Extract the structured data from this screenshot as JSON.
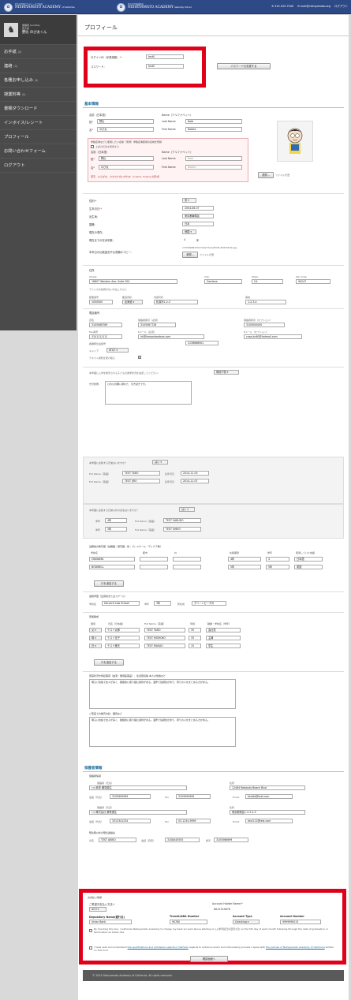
{
  "header": {
    "brand1_sub": "西大和学園アカデミーオブ米国",
    "brand1_name": "NISHIYAMATO ACADEMY",
    "brand1_loc": "of California",
    "brand2_sub": "西大和学園補習校",
    "brand2_name": "NISHIYAMATO ACADEMY",
    "brand2_loc": "Saturday School",
    "phone": "310-325-7040",
    "email": "mail@nishiyamato.org",
    "logout": "ログアウト"
  },
  "sidebar": {
    "user_role": "保護者 (Lomita)",
    "user_school": "西大和",
    "user_name": "野比 のび太くん",
    "items": [
      {
        "label": "お手紙",
        "count": "(0)"
      },
      {
        "label": "連絡",
        "count": "(0)"
      },
      {
        "label": "各種お申し込み",
        "count": "(0)"
      },
      {
        "label": "授業料等",
        "count": "(0)"
      },
      {
        "label": "書類ダウンロード",
        "count": ""
      },
      {
        "label": "インボイス/レシート",
        "count": ""
      },
      {
        "label": "プロフィール",
        "count": ""
      },
      {
        "label": "お問い合わせフォーム",
        "count": ""
      },
      {
        "label": "ログアウト",
        "count": ""
      }
    ]
  },
  "page": {
    "title": "プロフィール"
  },
  "login": {
    "id_label": "ログインID（半角英数）:",
    "id_value": "test0",
    "pw_label": "パスワード:",
    "pw_value": "test0",
    "pw_button": "パスワードを変更する"
  },
  "basic": {
    "title": "基本情報",
    "name_jp": "名前（日本語）",
    "name_en": "Name（アルファベット）",
    "sei_label": "姓",
    "sei": "野比",
    "mei_label": "名",
    "mei": "のび太",
    "last_label": "Last Name",
    "last": "Nobi",
    "first_label": "First Name",
    "first": "Nobita",
    "alias_note": "学籍名簿などに使用したい名前（筆頭）学籍名簿使用の名前を登録",
    "alias_check": "上記の氏名を使用する",
    "alias_sei": "野比",
    "alias_mei": "のび太",
    "alias_last": "Nobi",
    "alias_first": "Nobita",
    "alias_footer": "漢字、ひらがな、カタカナのいずれか（Lname, Fname の形式）",
    "photo_btn": "参照...",
    "photo_file": "ファイルが選",
    "gender_label": "性別:",
    "gender": "男",
    "dob_label": "生年月日:",
    "dob": "2004-06-07",
    "birthplace_label": "出生地:",
    "birthplace": "東京都練馬区",
    "nation_label": "国籍:",
    "nation": "日本",
    "visa_label": "現在の滞在:",
    "visa": "帰国",
    "years_label": "現在までの在米年数:",
    "years": "4",
    "years_unit": "年",
    "passport_label": "本年日の比較過去不る書類のコピー:",
    "passport_file": "17630988155474e077aaa83d6.45815632.jpg",
    "passport_btn": "参照..."
  },
  "address": {
    "title": "住所",
    "street_label": "Street:",
    "street": "16807 Western Ave, Suite 200",
    "city_label": "City:",
    "city": "Gardena",
    "state_label": "State:",
    "state": "CA",
    "zip_label": "Zip Code:",
    "zip": "90247",
    "jp_note": "アメリカの住所がない方はこちらに",
    "post_label": "郵便番号",
    "post": "1050000",
    "pref_label": "都道府県",
    "pref": "北海道",
    "city_jp_label": "市区町村",
    "city_jp": "札幌市1-2-3",
    "addr2_label": "番地",
    "addr2": "1-2-3-4"
  },
  "contact": {
    "title": "電話番号",
    "home_label": "自宅",
    "home": "3105068789",
    "cell_label": "保護者携帯（必須）",
    "cell": "3105567728",
    "cell2_label": "保護者携帯（オプション）",
    "cell2": "3100000000",
    "fax_label": "Fax番号",
    "fax": "3101111111",
    "email1_label": "Eメール（必須）",
    "email1": "hk@hampsteadsea.com",
    "email2_label": "Eメール（オプション）",
    "email2": "caaa.kn60@hotmail.com",
    "sms_label": "各種緊急電話号:",
    "sms": "2136668901",
    "carrier_label": "キャリア",
    "carrier": "AT&T",
    "text_check": "テキスト通知を受け取る"
  },
  "school": {
    "q1": "本学園に入学を希望される子どもの通学状況を決定してください:",
    "q1_value": "現地下校",
    "reason_label": "志望動機:",
    "reason": "ひのひの願い通れた、引き続きです。"
  },
  "siblings": {
    "q": "本学園に在籍する兄弟はいますか？",
    "ans": "はい",
    "rows": [
      {
        "name": "TEST TARO",
        "date": "2014-11-03"
      },
      {
        "name": "TEST JIRO",
        "date": "2014-11-07"
      }
    ],
    "name_label": "Full Name（英語）",
    "date_label": "生年月日",
    "q2": "本学園に在籍する兄弟以外の友達はいますか？",
    "ans2": "はい",
    "rows2": [
      {
        "grade": "4年",
        "name": "TEST SABURO"
      },
      {
        "grade": "3年",
        "name": "TEST SHIRO"
      }
    ],
    "grade_label": "学年"
  },
  "schools": {
    "title": "出願前の教育歴（幼稚園・保育園・塾・プレスクール・ディケア等）",
    "cols": [
      "学校名",
      "都市",
      "州",
      "在籍期間",
      "学年",
      "使用していた言語"
    ],
    "rows": [
      {
        "name": "OKAYAMA",
        "from": "4年",
        "to": "4",
        "lang": "日本語"
      },
      {
        "name": "BODWELL",
        "from": "5年",
        "to": "5年",
        "lang": "英語"
      }
    ],
    "add": "行を追加する"
  },
  "current": {
    "label": "最終学歴（出身校またはスクール）",
    "school_label": "学校名",
    "school": "Harvard Law School",
    "grade_label": "学年",
    "grade": "3年",
    "company_label": "所在地",
    "company": "グリーンビーチ州"
  },
  "family": {
    "title": "家族構成",
    "cols": [
      "関係",
      "氏名（日本語）",
      "Full Name（英語）",
      "年齢",
      "職業・学校名（学年）"
    ],
    "rows": [
      {
        "rel": "父",
        "jp": "テスト太郎",
        "en": "TEST TARO",
        "age": "35",
        "job": "会社員"
      },
      {
        "rel": "母",
        "jp": "テスト花子",
        "en": "TEST MOMOKO",
        "age": "33",
        "job": "主婦"
      },
      {
        "rel": "兄",
        "jp": "テスト雅夫",
        "en": "TEST MASAO",
        "age": "15",
        "job": "学生"
      }
    ],
    "add": "行を追加する"
  },
  "essay": {
    "q1": "家庭状況や特記事項（血液・服用医薬品）、生活環境等 本人の性格など",
    "a1": "明るい性格で友人が多く、積極的に取り組む姿勢がある。温厚で協調性があり、周りの人をまとめる力がある。",
    "q2": "ご家庭での教育方針、期待など",
    "a2": "明るい性格で友人が多く、積極的に取り組む姿勢がある。温厚で協調性があり、周りの人をまとめる力がある。"
  },
  "guardian": {
    "title": "保護者情報",
    "sub1": "保護者情報",
    "name_label": "保護者（氏名）",
    "name1": "○○商事 勝見優生",
    "addr_label": "住所",
    "addr1": "12484 Redondo Beach Blvd",
    "phone_label": "電話（代表）",
    "phone1": "3109999999",
    "fax_label": "Fax",
    "fax1": "3109999999",
    "email_label": "Email",
    "email1": "testdd@test.com",
    "name2": "○○株式会社 勝見優生",
    "addr2": "東京都港区1-2-3-4-5",
    "phone2": "3312341234",
    "fax2": "03-1234-9999",
    "email2": "test111@test.com",
    "em_label": "緊急時以外の緊急連絡先",
    "em_name_label": "氏名",
    "em_name": "TEST AKIKO",
    "em_phone_label": "電話（自宅）",
    "em_phone": "3108445555",
    "em_cell_label": "携帯",
    "em_cell": "3105566699"
  },
  "payment": {
    "title": "お支払い情報",
    "method_label": "ご希望お支払い方法:",
    "method": "ACH",
    "holder_label": "Account Holder Name:",
    "holder": "8012345678",
    "inst_label": "Depository Name(銀行名)",
    "inst": "Union Bank",
    "routing_label": "Transit/ABA Number",
    "routing": "90780",
    "type_label": "Account Type",
    "type": "Checking",
    "acct_label": "Account Number",
    "acct": "9999990013",
    "auth": "By checking this box, I authorize Nishiyamato Academy to charge my bank account above starting on (入学手続日の翌月1日) on the 5th day of each month following through the date of graduation or termination as tuition fee.",
    "policy_pre": "I have read and understand",
    "policy_link1": "the qualifications and admission selection methods",
    "policy_mid": "regards to entrance exam and interviewing process",
    "policy_mid2": "I agree with",
    "policy_link2": "the policies of Nishiyamato Academy of California",
    "policy_post": "written on this form.",
    "confirm": "確認画面へ"
  },
  "footer": {
    "copyright": "© 2024 Nishiyamato Academy of California. All rights reserved."
  }
}
